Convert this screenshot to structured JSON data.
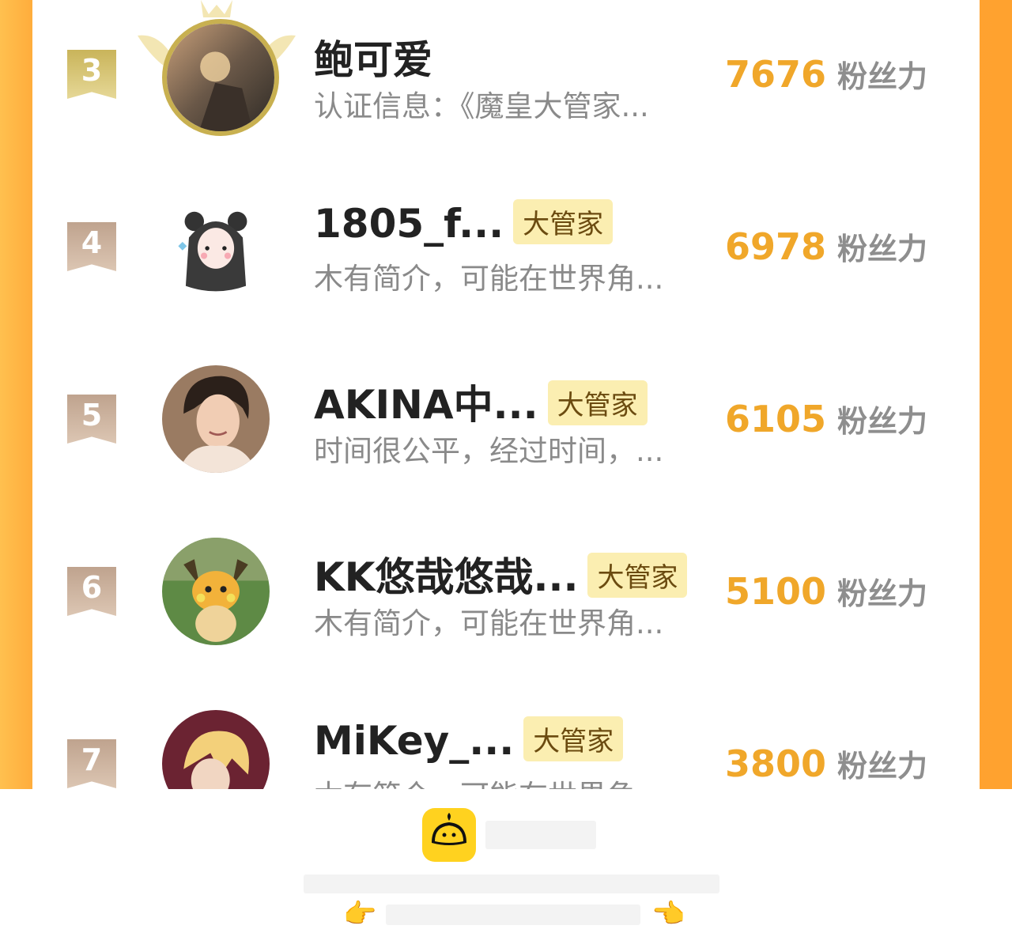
{
  "rows": [
    {
      "rank": "3",
      "name": "鲍可爱",
      "badge": "",
      "bio": "认证信息：《魔皇大管家...",
      "score": "7676",
      "unit": "粉丝力",
      "avatar": "sunset-photo-avatar"
    },
    {
      "rank": "4",
      "name": "1805_f...",
      "badge": "大管家",
      "bio": "木有简介，可能在世界角...",
      "score": "6978",
      "unit": "粉丝力",
      "avatar": "bear-ears-girl-avatar"
    },
    {
      "rank": "5",
      "name": "AKINA中...",
      "badge": "大管家",
      "bio": "时间很公平，经过时间，...",
      "score": "6105",
      "unit": "粉丝力",
      "avatar": "smiling-woman-avatar"
    },
    {
      "rank": "6",
      "name": "KK悠哉悠哉...",
      "badge": "大管家",
      "bio": "木有简介，可能在世界角...",
      "score": "5100",
      "unit": "粉丝力",
      "avatar": "raichu-avatar"
    },
    {
      "rank": "7",
      "name": "MiKey_...",
      "badge": "大管家",
      "bio": "木有简介，可能在世界角...",
      "score": "3800",
      "unit": "粉丝力",
      "avatar": "anime-blond-avatar"
    }
  ],
  "footer": {
    "app_icon": "bun-app-icon",
    "left_hand": "👉",
    "right_hand": "👈"
  },
  "colors": {
    "accent": "#f0a72a",
    "frame": "#ffa22f",
    "badge_bg": "#fbeeb1",
    "gold_rank": "#c9b45a",
    "tan_rank": "#bfa38e"
  }
}
